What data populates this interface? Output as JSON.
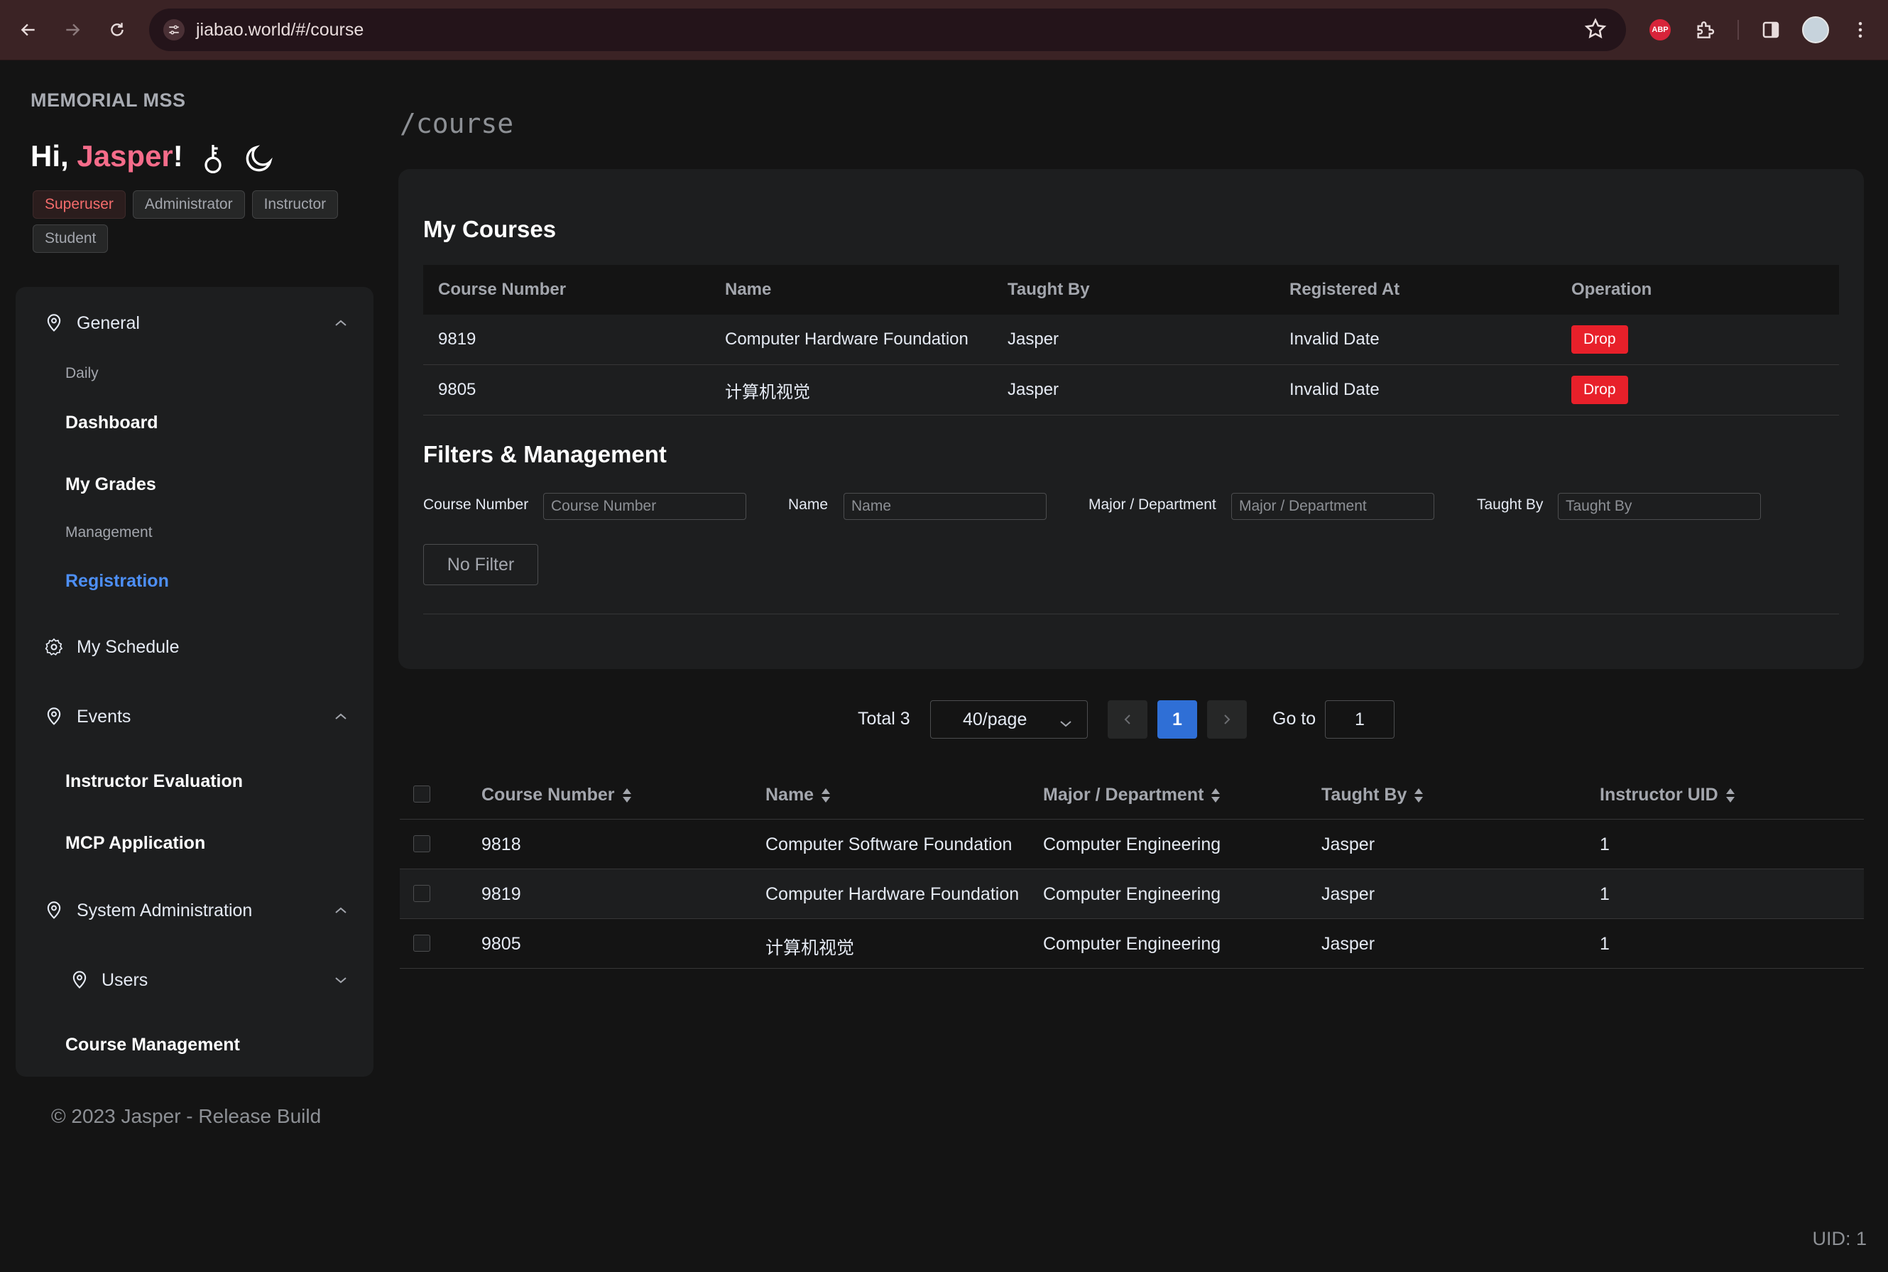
{
  "browser": {
    "url": "jiabao.world/#/course",
    "ext_abp_label": "ABP"
  },
  "sidebar": {
    "brand": "MEMORIAL MSS",
    "greeting_prefix": "Hi, ",
    "user_name": "Jasper",
    "greeting_suffix": "!",
    "roles": [
      "Superuser",
      "Administrator",
      "Instructor",
      "Student"
    ],
    "general": {
      "label": "General",
      "group_daily": "Daily",
      "dashboard": "Dashboard",
      "my_grades": "My Grades",
      "group_management": "Management",
      "registration": "Registration"
    },
    "my_schedule": "My Schedule",
    "events": {
      "label": "Events",
      "instructor_evaluation": "Instructor Evaluation",
      "mcp_application": "MCP Application"
    },
    "system_admin": {
      "label": "System Administration",
      "users": "Users",
      "course_management": "Course Management"
    },
    "copyright": "© 2023 Jasper - Release Build"
  },
  "main": {
    "route": "/course",
    "my_courses": {
      "title": "My Courses",
      "headers": [
        "Course Number",
        "Name",
        "Taught By",
        "Registered At",
        "Operation"
      ],
      "rows": [
        {
          "number": "9819",
          "name": "Computer Hardware Foundation",
          "taught_by": "Jasper",
          "registered_at": "Invalid Date",
          "action": "Drop"
        },
        {
          "number": "9805",
          "name": "计算机视觉",
          "taught_by": "Jasper",
          "registered_at": "Invalid Date",
          "action": "Drop"
        }
      ]
    },
    "filters": {
      "title": "Filters & Management",
      "course_number_label": "Course Number",
      "course_number_placeholder": "Course Number",
      "name_label": "Name",
      "name_placeholder": "Name",
      "major_label": "Major / Department",
      "major_placeholder": "Major / Department",
      "taught_by_label": "Taught By",
      "taught_by_placeholder": "Taught By",
      "no_filter": "No Filter"
    },
    "pagination": {
      "total": "Total 3",
      "page_size": "40/page",
      "current_page": "1",
      "goto_label": "Go to",
      "goto_value": "1"
    },
    "courses": {
      "headers": [
        "Course Number",
        "Name",
        "Major / Department",
        "Taught By",
        "Instructor UID"
      ],
      "rows": [
        {
          "number": "9818",
          "name": "Computer Software Foundation",
          "major": "Computer Engineering",
          "taught_by": "Jasper",
          "uid": "1"
        },
        {
          "number": "9819",
          "name": "Computer Hardware Foundation",
          "major": "Computer Engineering",
          "taught_by": "Jasper",
          "uid": "1"
        },
        {
          "number": "9805",
          "name": "计算机视觉",
          "major": "Computer Engineering",
          "taught_by": "Jasper",
          "uid": "1"
        }
      ]
    }
  },
  "footer_uid": "UID: 1",
  "colors": {
    "accent": "#f56c8a",
    "active_link": "#4d8ff5",
    "danger": "#e8202a",
    "page_bg": "#141414",
    "panel_bg": "#1d1e1f"
  }
}
